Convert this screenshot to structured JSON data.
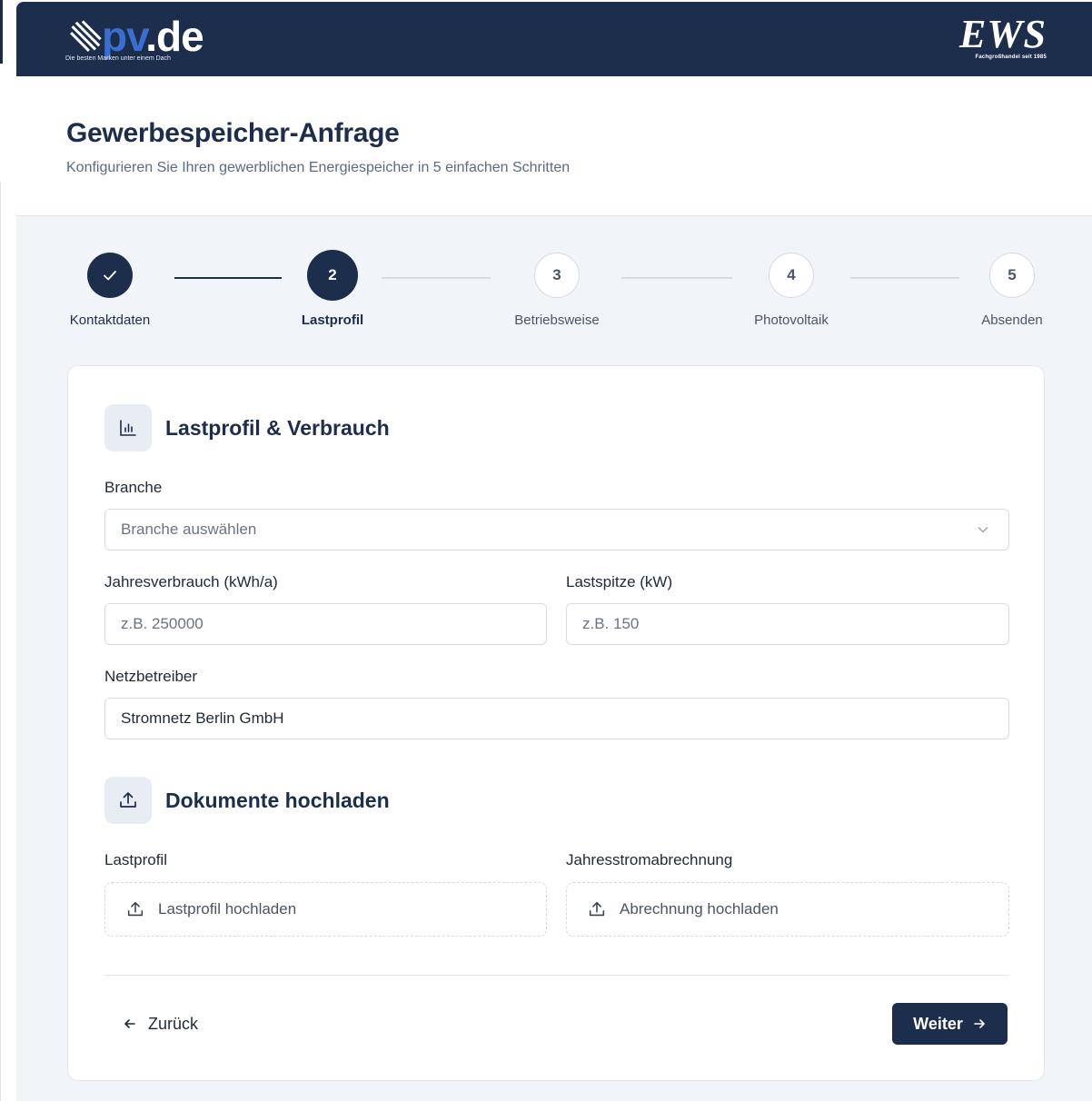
{
  "brand": {
    "logo_left_tagline": "Die besten Marken unter einem Dach",
    "logo_left_text_a": "pv",
    "logo_left_text_b": ".de",
    "logo_right_text": "EWS",
    "logo_right_tagline": "Fachgroßhandel seit 1985"
  },
  "header": {
    "title": "Gewerbespeicher-Anfrage",
    "subtitle": "Konfigurieren Sie Ihren gewerblichen Energiespeicher in 5 einfachen Schritten"
  },
  "stepper": {
    "steps": [
      {
        "number": "1",
        "label": "Kontaktdaten",
        "state": "done"
      },
      {
        "number": "2",
        "label": "Lastprofil",
        "state": "active"
      },
      {
        "number": "3",
        "label": "Betriebsweise",
        "state": "pending"
      },
      {
        "number": "4",
        "label": "Photovoltaik",
        "state": "pending"
      },
      {
        "number": "5",
        "label": "Absenden",
        "state": "pending"
      }
    ]
  },
  "load_section": {
    "title": "Lastprofil & Verbrauch",
    "icon": "bar-chart-icon",
    "branche": {
      "label": "Branche",
      "placeholder": "Branche auswählen"
    },
    "jahresverbrauch": {
      "label": "Jahresverbrauch (kWh/a)",
      "placeholder": "z.B. 250000",
      "value": ""
    },
    "lastspitze": {
      "label": "Lastspitze (kW)",
      "placeholder": "z.B. 150",
      "value": ""
    },
    "netzbetreiber": {
      "label": "Netzbetreiber",
      "value": "Stromnetz Berlin GmbH"
    }
  },
  "upload_section": {
    "title": "Dokumente hochladen",
    "icon": "upload-icon",
    "lastprofil": {
      "label": "Lastprofil",
      "button": "Lastprofil hochladen"
    },
    "abrechnung": {
      "label": "Jahresstromabrechnung",
      "button": "Abrechnung hochladen"
    }
  },
  "nav": {
    "back_label": "Zurück",
    "next_label": "Weiter"
  },
  "colors": {
    "navy": "#1d2d4c",
    "accent_blue": "#3a6fd1",
    "background": "#f1f4f8"
  }
}
